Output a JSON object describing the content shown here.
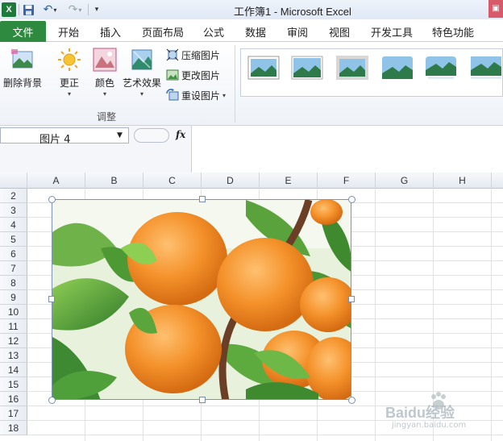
{
  "app": {
    "title": "工作簿1 -  Microsoft Excel",
    "icon_letter": "X"
  },
  "quick_access": {
    "icons": [
      "save-icon",
      "undo-icon",
      "redo-icon",
      "customize-icon"
    ]
  },
  "tabs": {
    "file": "文件",
    "items": [
      "开始",
      "插入",
      "页面布局",
      "公式",
      "数据",
      "审阅",
      "视图",
      "开发工具",
      "特色功能"
    ]
  },
  "ribbon": {
    "adjust_group": {
      "label": "调整",
      "remove_background": "删除背景",
      "corrections": "更正",
      "color": "颜色",
      "artistic_effects": "艺术效果",
      "compress": "压缩图片",
      "change": "更改图片",
      "reset": "重设图片"
    },
    "styles_count": 6
  },
  "formula_bar": {
    "name_box": "图片  4",
    "fx": "fx",
    "formula": ""
  },
  "sheet": {
    "columns": [
      "A",
      "B",
      "C",
      "D",
      "E",
      "F",
      "G",
      "H"
    ],
    "rows": [
      "2",
      "3",
      "4",
      "5",
      "6",
      "7",
      "8",
      "9",
      "10",
      "11",
      "12",
      "13",
      "14",
      "15",
      "16",
      "17",
      "18"
    ]
  },
  "picture": {
    "subject": "apricots",
    "colors": {
      "fruit": "#f4912a",
      "leaf": "#4d9a35",
      "bg": "#e8f1dc"
    }
  },
  "watermark": {
    "text": "Baidu经验",
    "sub": "jingyan.baidu.com"
  },
  "theme": {
    "file_tab": "#2e8a3f",
    "accent": "#2a5eaa"
  }
}
